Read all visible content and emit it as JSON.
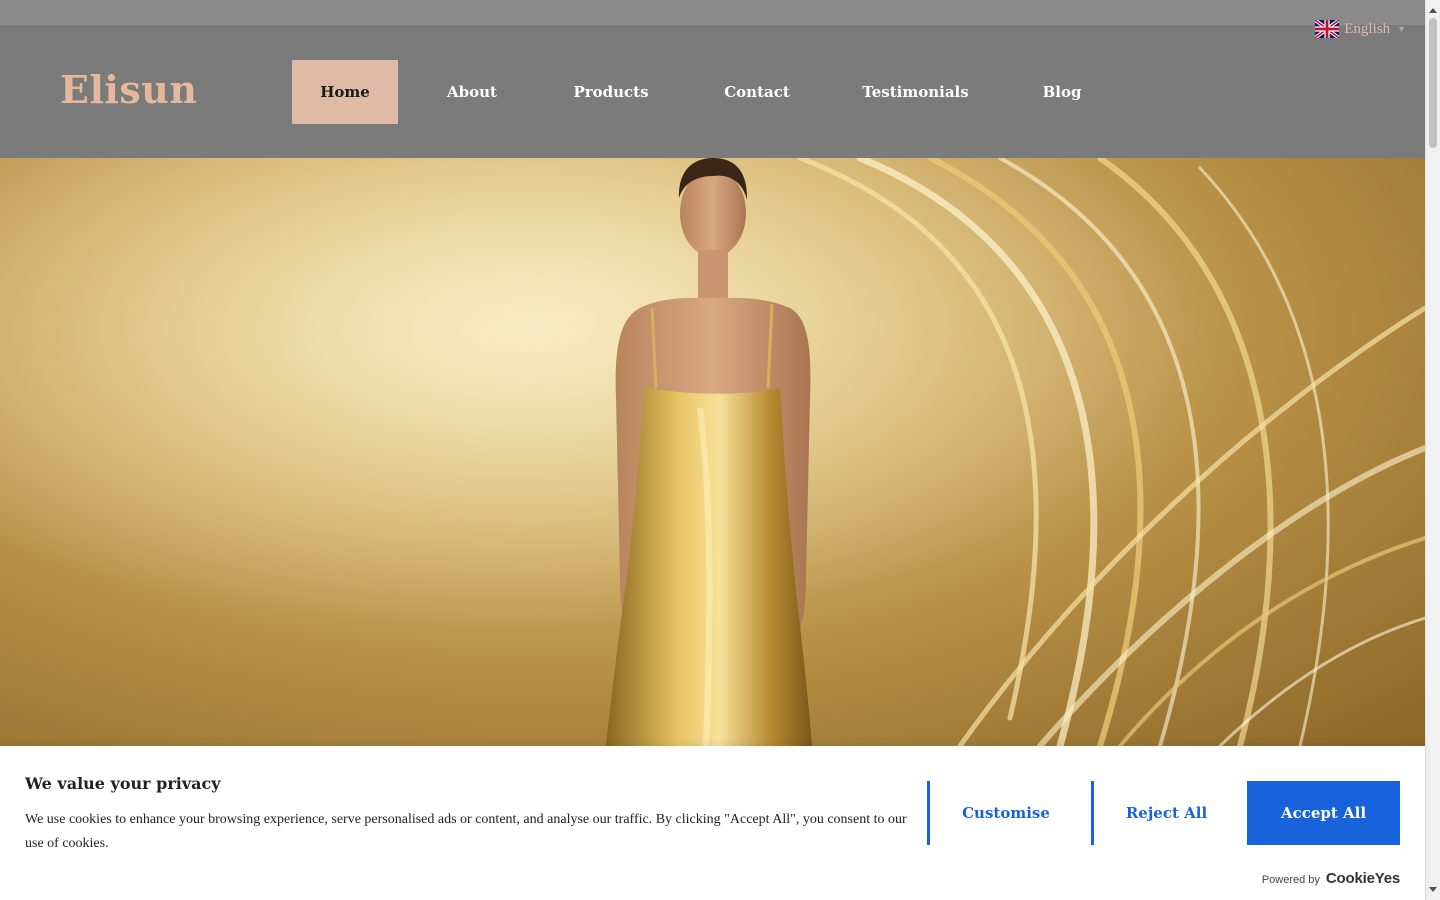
{
  "topbar": {
    "language": {
      "label": "English",
      "flag_icon": "uk-flag-icon"
    }
  },
  "header": {
    "logo": "Elisun",
    "nav": [
      {
        "label": "Home",
        "active": true
      },
      {
        "label": "About",
        "active": false
      },
      {
        "label": "Products",
        "active": false
      },
      {
        "label": "Contact",
        "active": false
      },
      {
        "label": "Testimonials",
        "active": false
      },
      {
        "label": "Blog",
        "active": false
      }
    ]
  },
  "cookie_banner": {
    "title": "We value your privacy",
    "text": "We use cookies to enhance your browsing experience, serve personalised ads or content, and analyse our traffic. By clicking \"Accept All\", you consent to our use of cookies.",
    "customise_label": "Customise",
    "reject_label": "Reject All",
    "accept_label": "Accept All",
    "powered_by": "Powered by",
    "brand": "CookieYes"
  },
  "colors": {
    "accent": "#1863dc",
    "logo": "#e5b89e",
    "nav_active_bg": "#dfbba6",
    "header_bg": "#7b7b7b"
  }
}
